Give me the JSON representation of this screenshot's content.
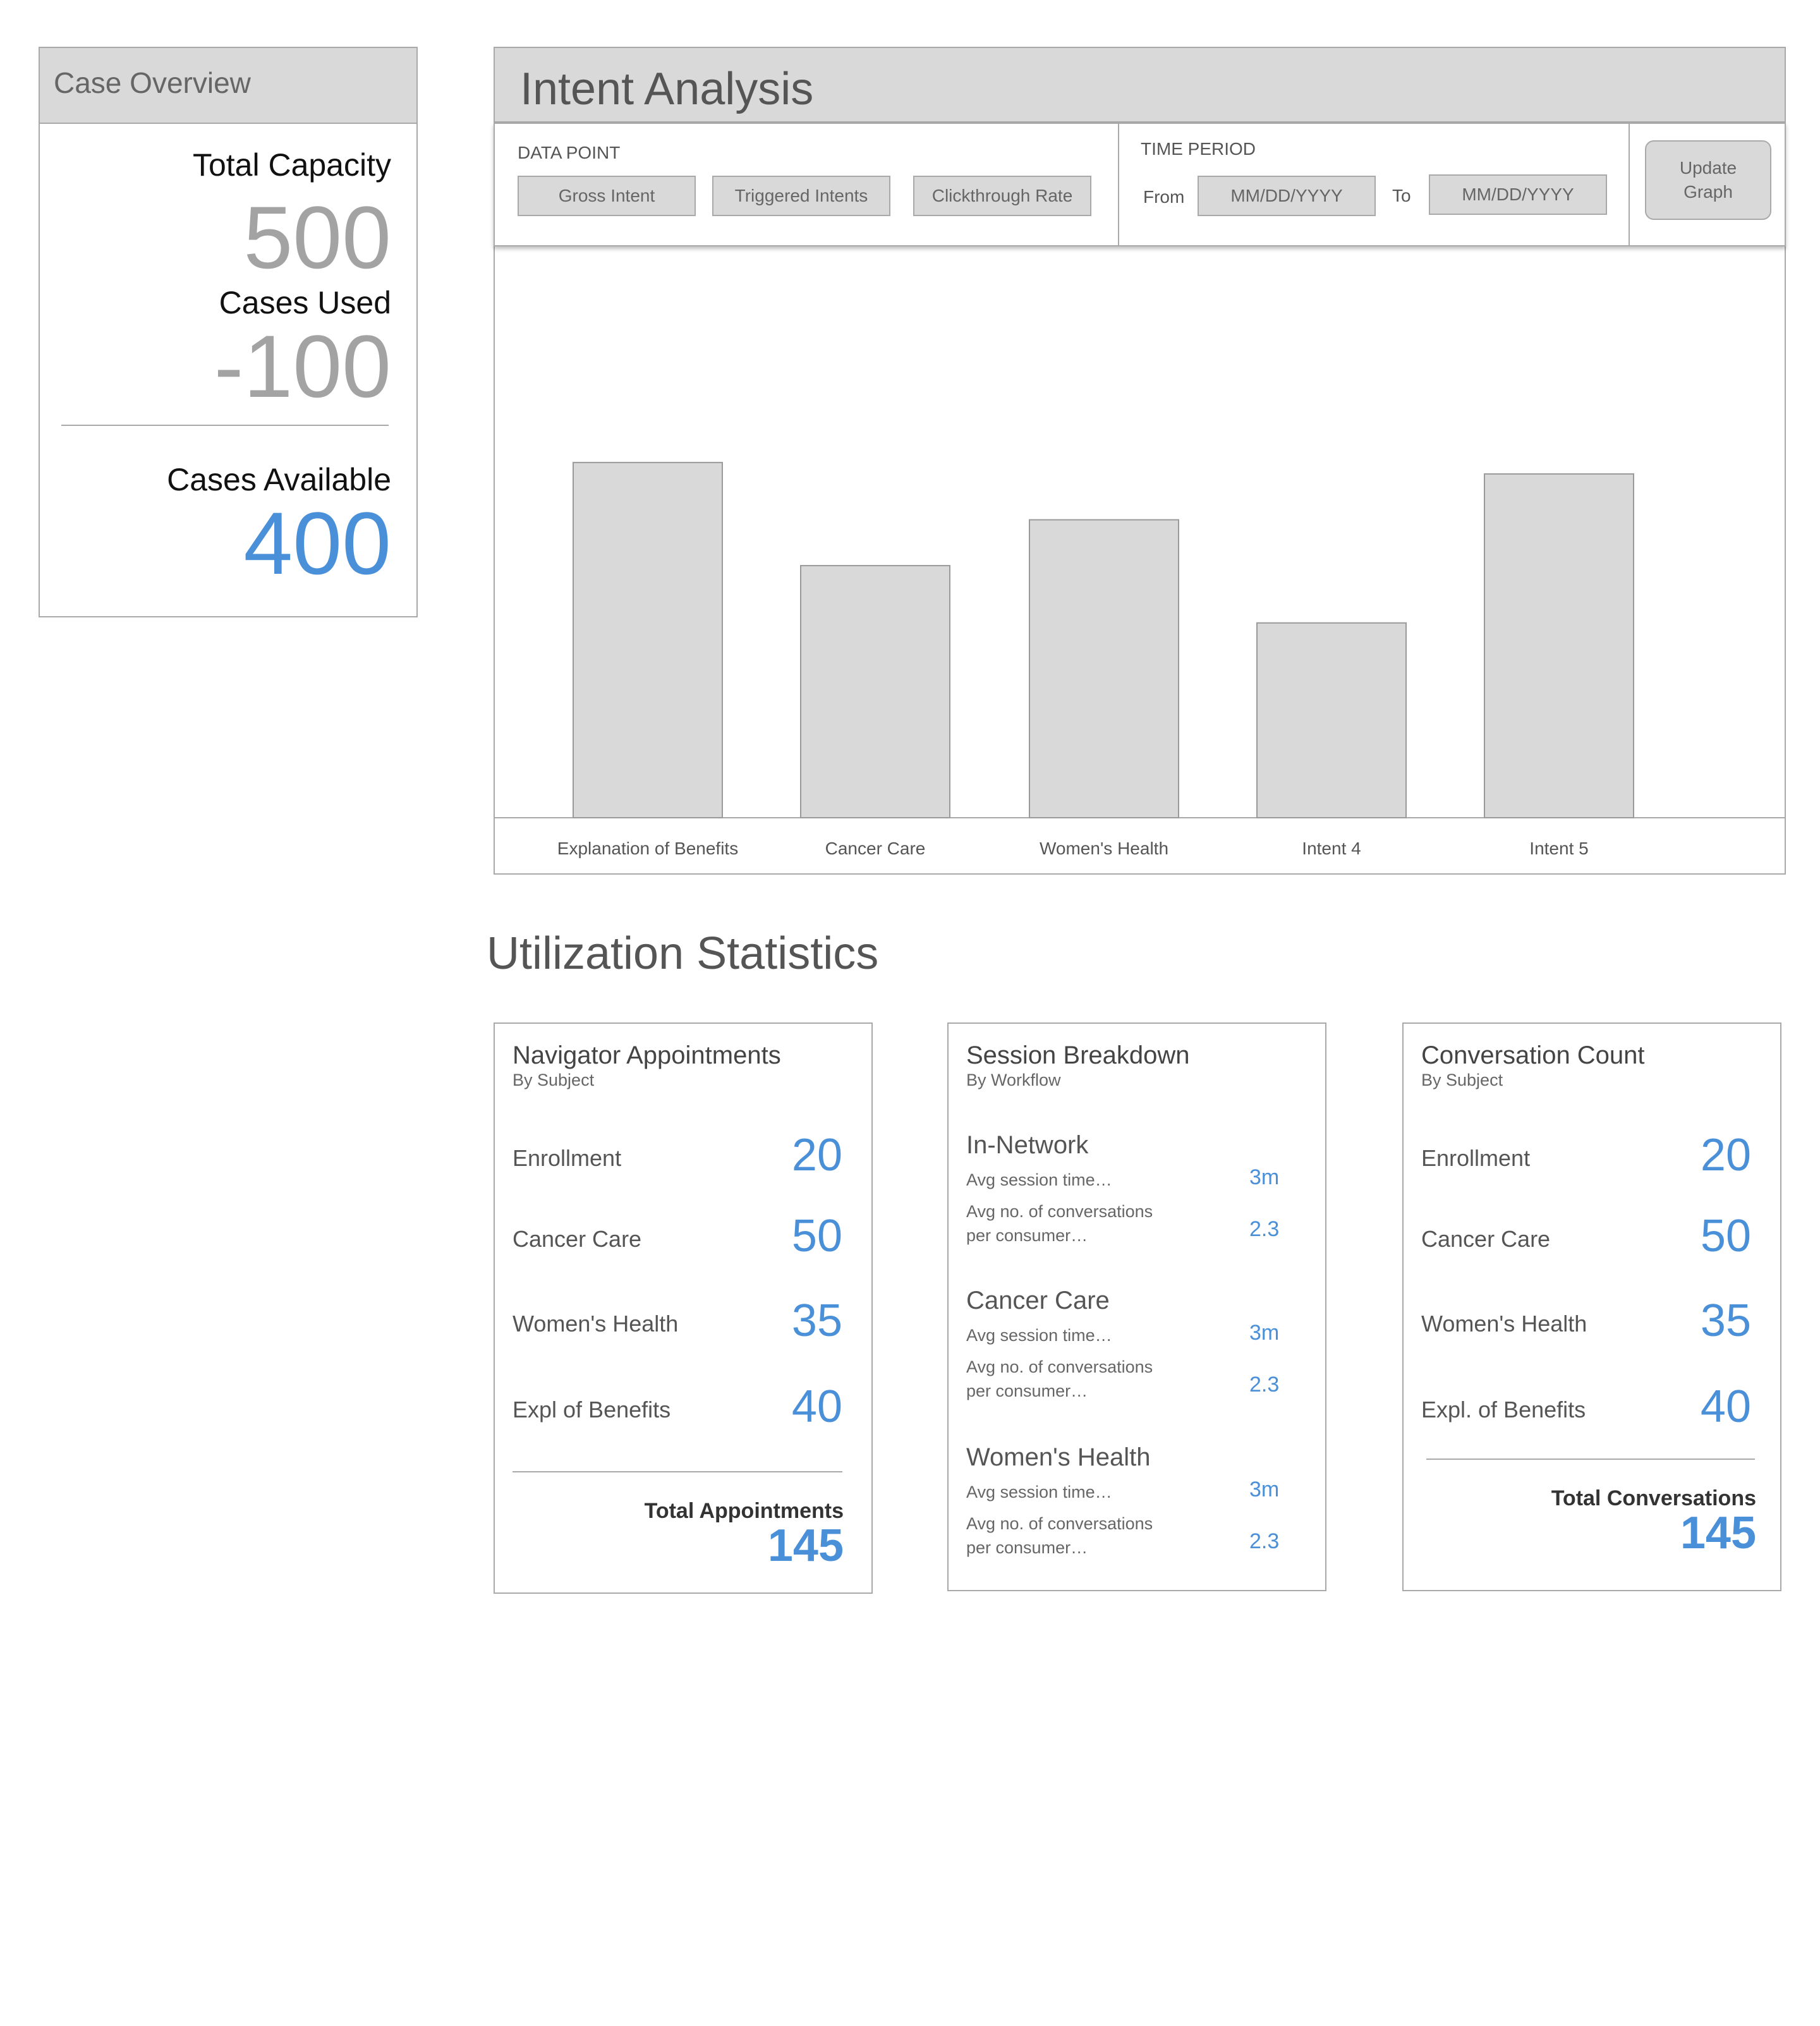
{
  "case_overview": {
    "title": "Case Overview",
    "total_capacity_label": "Total Capacity",
    "total_capacity_value": "500",
    "cases_used_label": "Cases Used",
    "cases_used_value": "-100",
    "cases_available_label": "Cases Available",
    "cases_available_value": "400"
  },
  "intent_analysis": {
    "title": "Intent Analysis",
    "data_point_label": "DATA POINT",
    "data_point_buttons": [
      "Gross Intent",
      "Triggered Intents",
      "Clickthrough Rate"
    ],
    "time_period_label": "TIME PERIOD",
    "from_label": "From",
    "from_placeholder": "MM/DD/YYYY",
    "to_label": "To",
    "to_placeholder": "MM/DD/YYYY",
    "update_button": "Update\nGraph"
  },
  "chart_data": {
    "type": "bar",
    "categories": [
      "Explanation of Benefits",
      "Cancer Care",
      "Women's Health",
      "Intent 4",
      "Intent 5"
    ],
    "values": [
      62,
      44,
      52,
      34,
      60
    ],
    "title": "",
    "xlabel": "",
    "ylabel": "",
    "ylim": [
      0,
      90
    ],
    "grid": false,
    "colors": {
      "bar_fill": "#d9d9d9",
      "bar_stroke": "#9a9a9a"
    }
  },
  "utilization": {
    "title": "Utilization Statistics",
    "navigator": {
      "title": "Navigator Appointments",
      "subtitle": "By Subject",
      "rows": [
        {
          "label": "Enrollment",
          "value": "20"
        },
        {
          "label": "Cancer Care",
          "value": "50"
        },
        {
          "label": "Women's Health",
          "value": "35"
        },
        {
          "label": "Expl of Benefits",
          "value": "40"
        }
      ],
      "total_label": "Total Appointments",
      "total_value": "145"
    },
    "session": {
      "title": "Session Breakdown",
      "subtitle": "By Workflow",
      "workflows": [
        {
          "name": "In-Network",
          "session_label": "Avg session time…",
          "session_value": "3m",
          "conv_label_1": "Avg no. of conversations",
          "conv_label_2": "per consumer…",
          "conv_value": "2.3"
        },
        {
          "name": "Cancer Care",
          "session_label": "Avg session time…",
          "session_value": "3m",
          "conv_label_1": "Avg no. of conversations",
          "conv_label_2": "per consumer…",
          "conv_value": "2.3"
        },
        {
          "name": "Women's Health",
          "session_label": "Avg session time…",
          "session_value": "3m",
          "conv_label_1": "Avg no. of conversations",
          "conv_label_2": "per consumer…",
          "conv_value": "2.3"
        }
      ]
    },
    "conversation": {
      "title": "Conversation Count",
      "subtitle": "By Subject",
      "rows": [
        {
          "label": "Enrollment",
          "value": "20"
        },
        {
          "label": "Cancer Care",
          "value": "50"
        },
        {
          "label": "Women's Health",
          "value": "35"
        },
        {
          "label": "Expl. of Benefits",
          "value": "40"
        }
      ],
      "total_label": "Total Conversations",
      "total_value": "145"
    }
  },
  "colors": {
    "accent": "#4a90d9",
    "panel_header": "#d9d9d9",
    "border": "#a9a9a9",
    "muted_number": "#a3a3a3"
  }
}
